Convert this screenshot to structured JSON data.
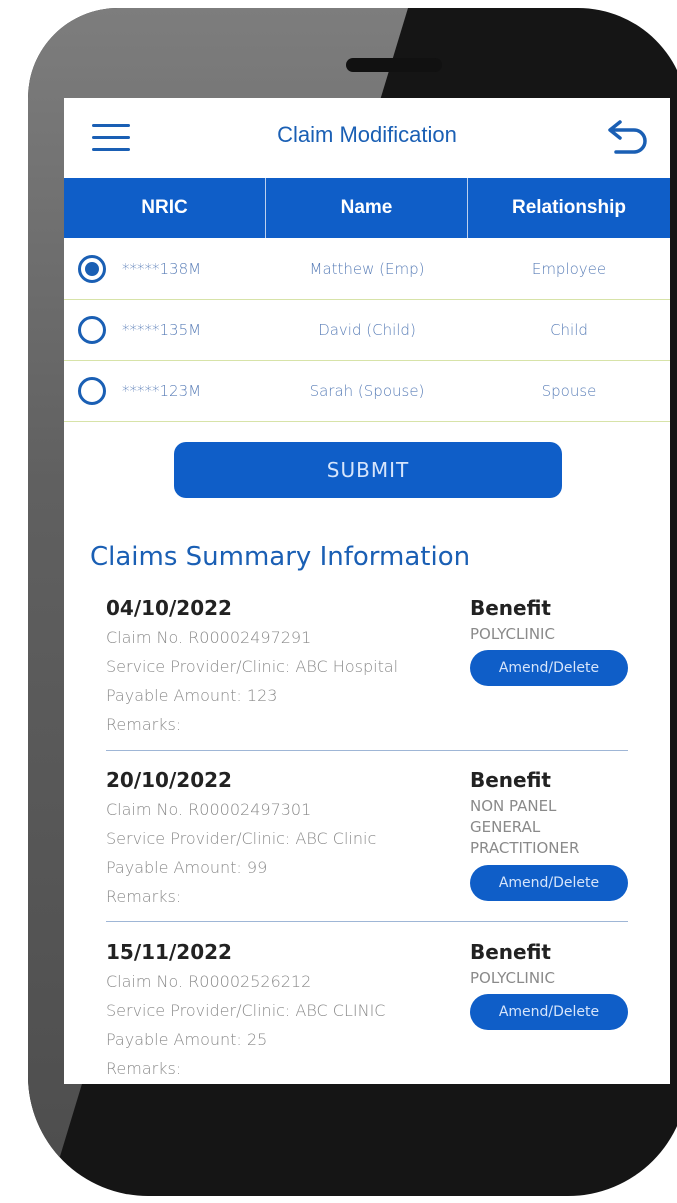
{
  "header": {
    "title": "Claim Modification",
    "accent_color": "#1a5fb4",
    "menu_icon": "hamburger-menu-icon",
    "back_icon": "undo-arrow-icon"
  },
  "table": {
    "headers": [
      "NRIC",
      "Name",
      "Relationship"
    ],
    "header_color": "#0f5ec8",
    "rows": [
      {
        "selected": true,
        "nric": "*****138M",
        "name": "Matthew (Emp)",
        "relationship": "Employee"
      },
      {
        "selected": false,
        "nric": "*****135M",
        "name": "David (Child)",
        "relationship": "Child"
      },
      {
        "selected": false,
        "nric": "*****123M",
        "name": "Sarah (Spouse)",
        "relationship": "Spouse"
      }
    ]
  },
  "submit_label": "SUBMIT",
  "summary": {
    "title": "Claims Summary Information",
    "claims": [
      {
        "date": "04/10/2022",
        "claim_no": "Claim No. R00002497291",
        "provider": "Service Provider/Clinic: ABC Hospital",
        "amount": "Payable Amount: 123",
        "remarks": "Remarks:",
        "benefit_label": "Benefit",
        "benefit_lines": [
          "POLYCLINIC"
        ],
        "action_label": "Amend/Delete"
      },
      {
        "date": "20/10/2022",
        "claim_no": "Claim No. R00002497301",
        "provider": "Service Provider/Clinic: ABC Clinic",
        "amount": "Payable Amount: 99",
        "remarks": "Remarks:",
        "benefit_label": "Benefit",
        "benefit_lines": [
          "NON PANEL",
          "GENERAL",
          "PRACTITIONER"
        ],
        "action_label": "Amend/Delete"
      },
      {
        "date": "15/11/2022",
        "claim_no": "Claim No. R00002526212",
        "provider": "Service Provider/Clinic: ABC CLINIC",
        "amount": "Payable Amount: 25",
        "remarks": "Remarks:",
        "benefit_label": "Benefit",
        "benefit_lines": [
          "POLYCLINIC"
        ],
        "action_label": "Amend/Delete"
      }
    ]
  }
}
